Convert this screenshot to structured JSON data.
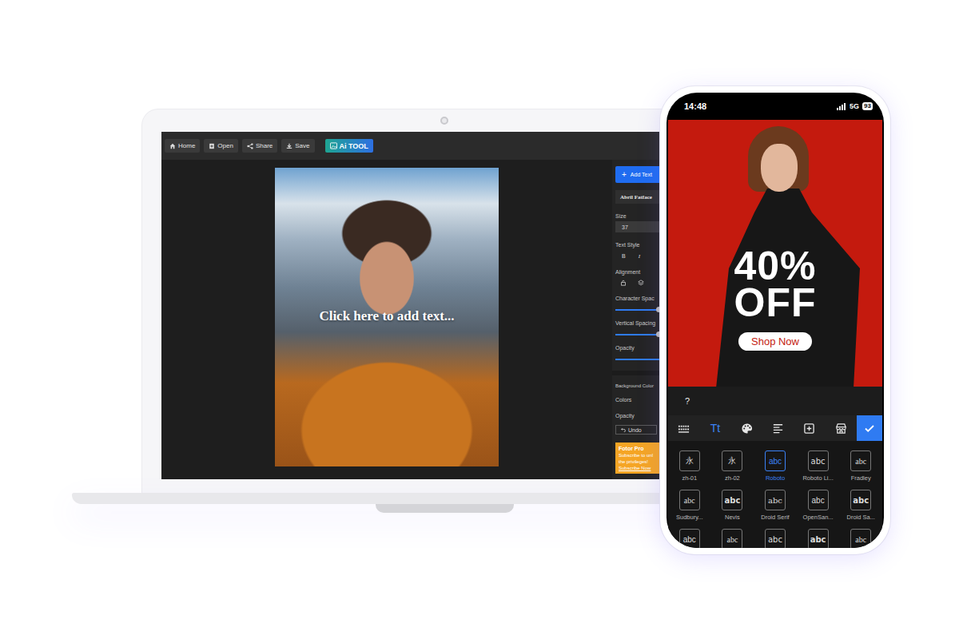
{
  "editor": {
    "toolbar": [
      {
        "label": "Home"
      },
      {
        "label": "Open"
      },
      {
        "label": "Share"
      },
      {
        "label": "Save"
      }
    ],
    "ai_tool": {
      "label": "Ai TOOL"
    },
    "canvas": {
      "text": "Click here to add text..."
    },
    "panel": {
      "add_text": {
        "icon": "+",
        "label": "Add Text"
      },
      "font": "Abril Fatface",
      "size": {
        "label": "Size",
        "value": "37"
      },
      "text_style": {
        "label": "Text Style",
        "buttons": [
          "B",
          "I"
        ]
      },
      "alignment": {
        "label": "Alignment"
      },
      "sliders": [
        {
          "label": "Character Spac",
          "level": 0.95
        },
        {
          "label": "Vertical Spacing",
          "level": 0.95
        },
        {
          "label": "Opacity",
          "level": 1
        }
      ],
      "background": {
        "label": "Background Color",
        "colors_label": "Colors",
        "opacity_label": "Opacity"
      },
      "undo": "Undo",
      "promo": {
        "title": "Fotor Pro",
        "lines": [
          "Subscribe to unl",
          "the privileges!"
        ],
        "link": "Subscribe Now"
      }
    }
  },
  "phone": {
    "status": {
      "time": "14:48",
      "network": "5G",
      "battery": "93"
    },
    "design": {
      "headline": [
        "40%",
        "OFF"
      ],
      "button": "Shop Now"
    },
    "help": "?",
    "tools": [
      {
        "kind": "keyboard",
        "selected": false
      },
      {
        "kind": "text",
        "label": "Tt",
        "selected": true
      },
      {
        "kind": "palette",
        "selected": false
      },
      {
        "kind": "align",
        "selected": false
      },
      {
        "kind": "add",
        "selected": false
      },
      {
        "kind": "store",
        "selected": false
      }
    ],
    "fonts": [
      {
        "glyph": "永",
        "label": "zh-01",
        "selected": false
      },
      {
        "glyph": "永",
        "label": "zh-02",
        "selected": false
      },
      {
        "glyph": "abc",
        "label": "Roboto",
        "selected": true
      },
      {
        "glyph": "abc",
        "label": "Roboto Li...",
        "selected": false
      },
      {
        "glyph": "abc",
        "label": "Fradley",
        "selected": false
      },
      {
        "glyph": "abc",
        "label": "Sudbury...",
        "selected": false
      },
      {
        "glyph": "abc",
        "label": "Nevis",
        "selected": false
      },
      {
        "glyph": "abc",
        "label": "Droid Serif",
        "selected": false
      },
      {
        "glyph": "abc",
        "label": "OpenSan...",
        "selected": false
      },
      {
        "glyph": "abc",
        "label": "Droid Sa...",
        "selected": false
      },
      {
        "glyph": "abc",
        "selected": false
      },
      {
        "glyph": "abc",
        "selected": false
      },
      {
        "glyph": "abc",
        "selected": false
      },
      {
        "glyph": "abc",
        "selected": false
      },
      {
        "glyph": "abc",
        "selected": false
      }
    ]
  }
}
